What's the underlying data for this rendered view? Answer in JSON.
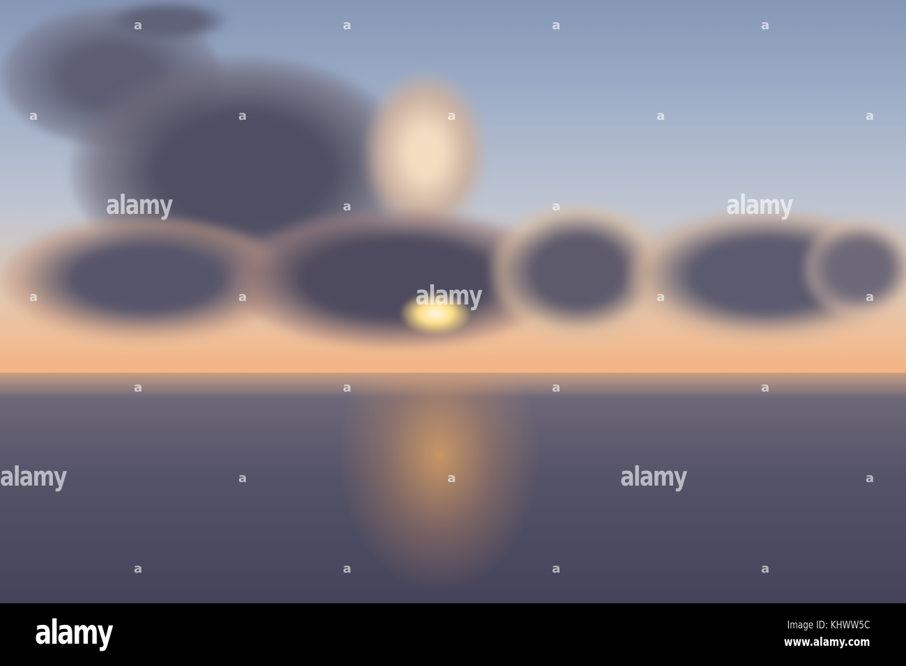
{
  "photo": {
    "subject": "sunset over sea",
    "colors": {
      "sky_top": "#8597b6",
      "horizon": "#f0b38a",
      "sea": "#45435a",
      "sun": "#ffe08a"
    }
  },
  "watermark": {
    "brand": "alamy",
    "mark": "a"
  },
  "footer": {
    "logo": "alamy",
    "image_id": "Image ID: KHWW5C",
    "url": "www.alamy.com"
  }
}
